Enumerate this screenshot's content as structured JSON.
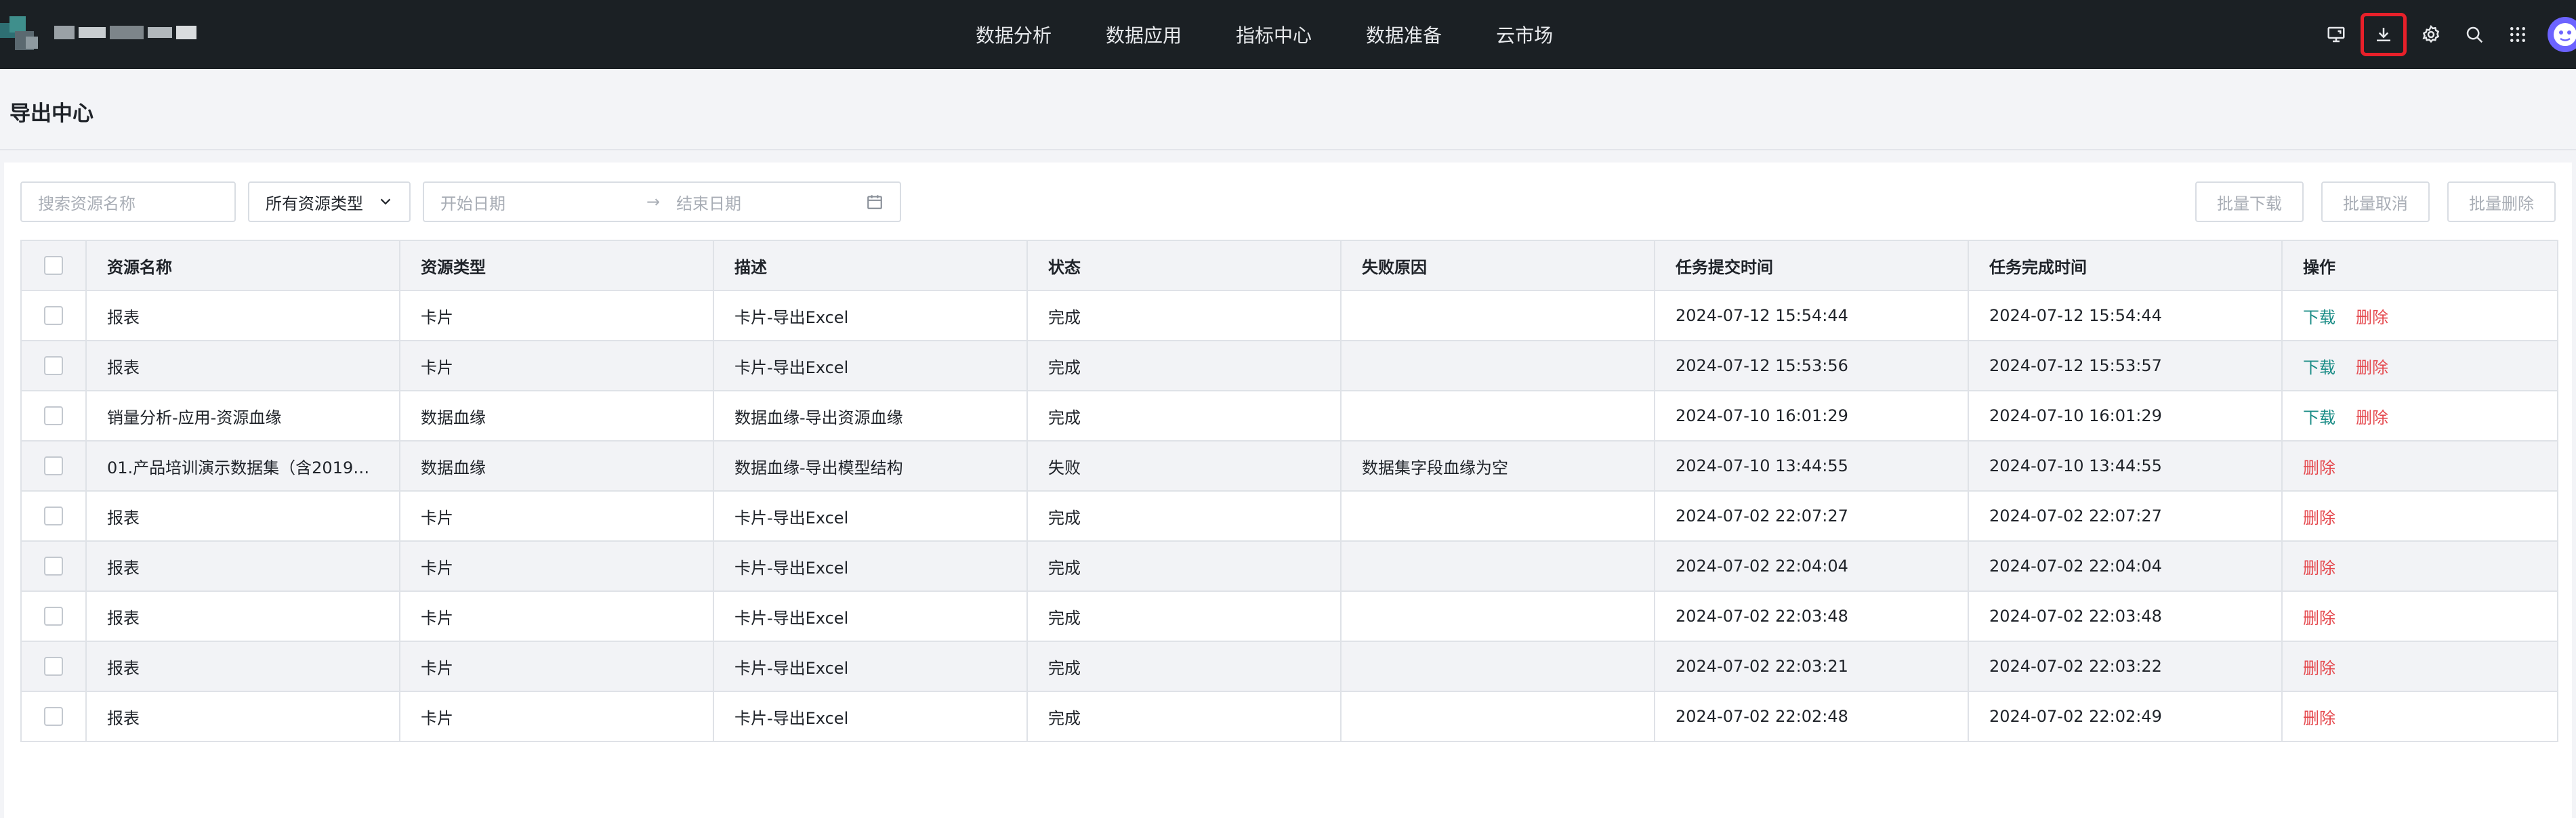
{
  "nav": {
    "items": [
      "数据分析",
      "数据应用",
      "指标中心",
      "数据准备",
      "云市场"
    ]
  },
  "tools": [
    "monitor-icon",
    "download-icon",
    "gear-icon",
    "search-icon",
    "apps-grid-icon"
  ],
  "colors": {
    "topbar": "#1b2024",
    "active_outline": "#e8202a",
    "download_link": "#1a8c86",
    "delete_link": "#e5484d"
  },
  "page": {
    "title": "导出中心"
  },
  "filters": {
    "search_placeholder": "搜索资源名称",
    "type_select": "所有资源类型",
    "start_date_placeholder": "开始日期",
    "end_date_placeholder": "结束日期"
  },
  "batch": {
    "download": "批量下载",
    "cancel": "批量取消",
    "delete": "批量删除"
  },
  "table": {
    "headers": [
      "资源名称",
      "资源类型",
      "描述",
      "状态",
      "失败原因",
      "任务提交时间",
      "任务完成时间",
      "操作"
    ],
    "actions": {
      "download": "下载",
      "delete": "删除"
    },
    "rows": [
      {
        "name": "报表",
        "type": "卡片",
        "desc": "卡片-导出Excel",
        "status": "完成",
        "reason": "",
        "submit": "2024-07-12 15:54:44",
        "finish": "2024-07-12 15:54:44",
        "downloadable": true
      },
      {
        "name": "报表",
        "type": "卡片",
        "desc": "卡片-导出Excel",
        "status": "完成",
        "reason": "",
        "submit": "2024-07-12 15:53:56",
        "finish": "2024-07-12 15:53:57",
        "downloadable": true
      },
      {
        "name": "销量分析-应用-资源血缘",
        "type": "数据血缘",
        "desc": "数据血缘-导出资源血缘",
        "status": "完成",
        "reason": "",
        "submit": "2024-07-10 16:01:29",
        "finish": "2024-07-10 16:01:29",
        "downloadable": true
      },
      {
        "name": "01.产品培训演示数据集（含2019数...",
        "type": "数据血缘",
        "desc": "数据血缘-导出模型结构",
        "status": "失败",
        "reason": "数据集字段血缘为空",
        "submit": "2024-07-10 13:44:55",
        "finish": "2024-07-10 13:44:55",
        "downloadable": false
      },
      {
        "name": "报表",
        "type": "卡片",
        "desc": "卡片-导出Excel",
        "status": "完成",
        "reason": "",
        "submit": "2024-07-02 22:07:27",
        "finish": "2024-07-02 22:07:27",
        "downloadable": false
      },
      {
        "name": "报表",
        "type": "卡片",
        "desc": "卡片-导出Excel",
        "status": "完成",
        "reason": "",
        "submit": "2024-07-02 22:04:04",
        "finish": "2024-07-02 22:04:04",
        "downloadable": false
      },
      {
        "name": "报表",
        "type": "卡片",
        "desc": "卡片-导出Excel",
        "status": "完成",
        "reason": "",
        "submit": "2024-07-02 22:03:48",
        "finish": "2024-07-02 22:03:48",
        "downloadable": false
      },
      {
        "name": "报表",
        "type": "卡片",
        "desc": "卡片-导出Excel",
        "status": "完成",
        "reason": "",
        "submit": "2024-07-02 22:03:21",
        "finish": "2024-07-02 22:03:22",
        "downloadable": false
      },
      {
        "name": "报表",
        "type": "卡片",
        "desc": "卡片-导出Excel",
        "status": "完成",
        "reason": "",
        "submit": "2024-07-02 22:02:48",
        "finish": "2024-07-02 22:02:49",
        "downloadable": false
      }
    ]
  }
}
